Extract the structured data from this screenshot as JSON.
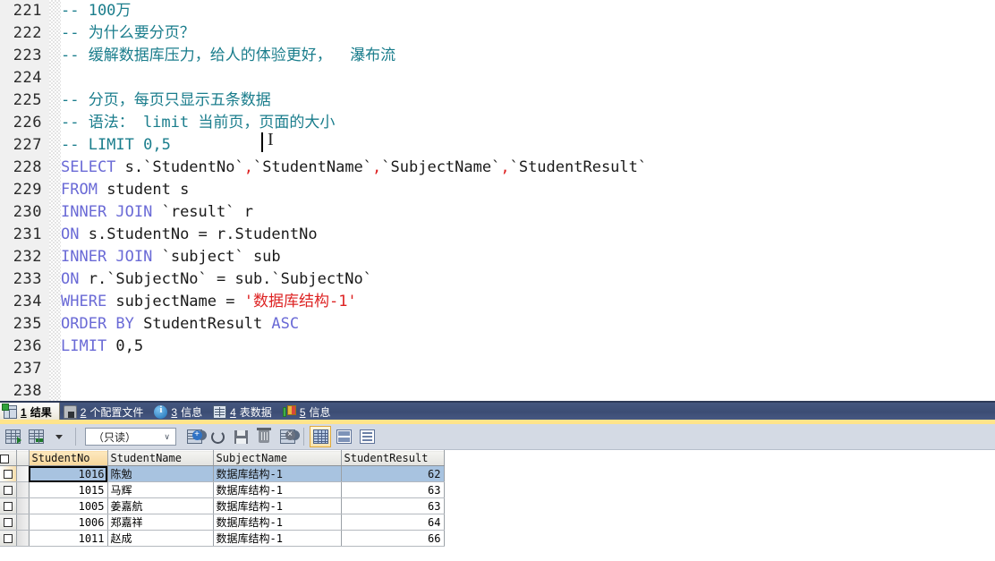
{
  "editor": {
    "first_line_number": 221,
    "lines": [
      {
        "num": "221",
        "tokens": [
          {
            "t": "comment",
            "v": "-- 100万"
          }
        ]
      },
      {
        "num": "222",
        "tokens": [
          {
            "t": "comment",
            "v": "-- 为什么要分页？"
          }
        ]
      },
      {
        "num": "223",
        "tokens": [
          {
            "t": "comment",
            "v": "-- 缓解数据库压力，给人的体验更好，  瀑布流"
          }
        ]
      },
      {
        "num": "224",
        "tokens": [
          {
            "t": "plain",
            "v": ""
          }
        ]
      },
      {
        "num": "225",
        "tokens": [
          {
            "t": "comment",
            "v": "-- 分页，每页只显示五条数据"
          }
        ]
      },
      {
        "num": "226",
        "tokens": [
          {
            "t": "comment",
            "v": "-- 语法： limit 当前页，页面的大小"
          }
        ]
      },
      {
        "num": "227",
        "tokens": [
          {
            "t": "comment",
            "v": "-- LIMIT 0,5"
          }
        ]
      },
      {
        "num": "228",
        "tokens": [
          {
            "t": "kw",
            "v": "SELECT "
          },
          {
            "t": "plain",
            "v": "s.`StudentNo`"
          },
          {
            "t": "str",
            "v": ","
          },
          {
            "t": "plain",
            "v": "`StudentName`"
          },
          {
            "t": "str",
            "v": ","
          },
          {
            "t": "plain",
            "v": "`SubjectName`"
          },
          {
            "t": "str",
            "v": ","
          },
          {
            "t": "plain",
            "v": "`StudentResult`"
          }
        ]
      },
      {
        "num": "229",
        "tokens": [
          {
            "t": "kw",
            "v": "FROM "
          },
          {
            "t": "plain",
            "v": "student s"
          }
        ]
      },
      {
        "num": "230",
        "tokens": [
          {
            "t": "kw",
            "v": "INNER JOIN "
          },
          {
            "t": "plain",
            "v": "`result` r"
          }
        ]
      },
      {
        "num": "231",
        "tokens": [
          {
            "t": "kw",
            "v": "ON "
          },
          {
            "t": "plain",
            "v": "s.StudentNo = r.StudentNo"
          }
        ]
      },
      {
        "num": "232",
        "tokens": [
          {
            "t": "kw",
            "v": "INNER JOIN "
          },
          {
            "t": "plain",
            "v": "`subject` sub"
          }
        ]
      },
      {
        "num": "233",
        "tokens": [
          {
            "t": "kw",
            "v": "ON "
          },
          {
            "t": "plain",
            "v": "r.`SubjectNo` = sub.`SubjectNo`"
          }
        ]
      },
      {
        "num": "234",
        "tokens": [
          {
            "t": "kw",
            "v": "WHERE "
          },
          {
            "t": "plain",
            "v": "subjectName = "
          },
          {
            "t": "str",
            "v": "'数据库结构-1'"
          }
        ]
      },
      {
        "num": "235",
        "tokens": [
          {
            "t": "kw",
            "v": "ORDER BY "
          },
          {
            "t": "plain",
            "v": "StudentResult "
          },
          {
            "t": "kw",
            "v": "ASC"
          }
        ]
      },
      {
        "num": "236",
        "tokens": [
          {
            "t": "kw",
            "v": "LIMIT "
          },
          {
            "t": "plain",
            "v": "0,5"
          }
        ]
      },
      {
        "num": "237",
        "tokens": [
          {
            "t": "plain",
            "v": ""
          }
        ]
      },
      {
        "num": "238",
        "tokens": [
          {
            "t": "plain",
            "v": ""
          }
        ]
      }
    ]
  },
  "tabs": [
    {
      "num": "1",
      "label": "结果",
      "icon": "result-grid-icon",
      "active": true
    },
    {
      "num": "2",
      "label": "个配置文件",
      "icon": "profile-lock-icon",
      "active": false
    },
    {
      "num": "3",
      "label": "信息",
      "icon": "info-circle-icon",
      "active": false
    },
    {
      "num": "4",
      "label": "表数据",
      "icon": "table-data-icon",
      "active": false
    },
    {
      "num": "5",
      "label": "信息",
      "icon": "color-blocks-icon",
      "active": false
    }
  ],
  "grid_toolbar": {
    "mode_value": "（只读）",
    "chevron": "∨",
    "buttons": [
      {
        "name": "grid-view-button",
        "icon": "grid-icon"
      },
      {
        "name": "export-grid-button",
        "icon": "grid-export-icon"
      },
      {
        "name": "export-dropdown-button",
        "icon": "chevron-down-icon"
      },
      {
        "name": "add-record-button",
        "icon": "add-record-icon"
      },
      {
        "name": "refresh-button",
        "icon": "refresh-icon"
      },
      {
        "name": "save-record-button",
        "icon": "save-icon"
      },
      {
        "name": "delete-record-button",
        "icon": "trash-icon"
      },
      {
        "name": "remove-grid-button",
        "icon": "grid-remove-icon"
      },
      {
        "name": "grid-layout-button",
        "icon": "grid-layout-icon"
      },
      {
        "name": "split-layout-button",
        "icon": "split-view-icon"
      },
      {
        "name": "form-layout-button",
        "icon": "form-view-icon"
      }
    ]
  },
  "result_grid": {
    "columns": [
      "StudentNo",
      "StudentName",
      "SubjectName",
      "StudentResult"
    ],
    "selected_column_index": 0,
    "selected_row_index": 0,
    "focused_cell": {
      "row": 0,
      "col": 0
    },
    "rows": [
      {
        "StudentNo": "1016",
        "StudentName": "陈勉",
        "SubjectName": "数据库结构-1",
        "StudentResult": "62"
      },
      {
        "StudentNo": "1015",
        "StudentName": "马辉",
        "SubjectName": "数据库结构-1",
        "StudentResult": "63"
      },
      {
        "StudentNo": "1005",
        "StudentName": "姜嘉航",
        "SubjectName": "数据库结构-1",
        "StudentResult": "63"
      },
      {
        "StudentNo": "1006",
        "StudentName": "郑嘉祥",
        "SubjectName": "数据库结构-1",
        "StudentResult": "64"
      },
      {
        "StudentNo": "1011",
        "StudentName": "赵成",
        "SubjectName": "数据库结构-1",
        "StudentResult": "66"
      }
    ]
  },
  "colors": {
    "comment": "#1a7d8c",
    "keyword": "#6a6ad6",
    "string": "#dd2222",
    "tabbar_bg": "#44567f",
    "tabbar_underline": "#ffe48a",
    "selection": "#a8c3e0",
    "header_selected": "#f6d69a"
  }
}
